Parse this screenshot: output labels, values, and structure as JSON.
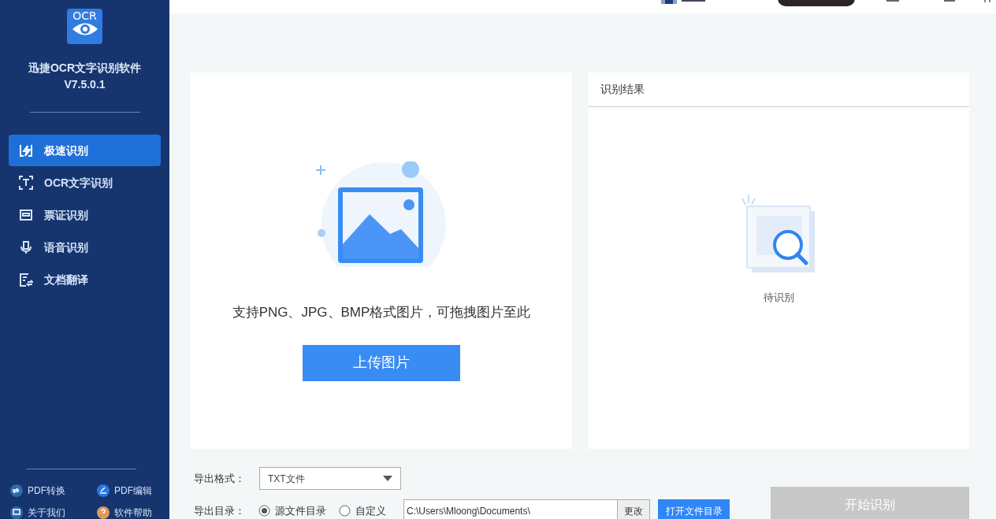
{
  "app": {
    "logo_text": "OCR",
    "name": "迅捷OCR文字识别软件",
    "version": "V7.5.0.1"
  },
  "nav": [
    {
      "label": "极速识别",
      "kind": "flash",
      "selected": true
    },
    {
      "label": "OCR文字识别",
      "kind": "text",
      "selected": false
    },
    {
      "label": "票证识别",
      "kind": "ticket",
      "selected": false
    },
    {
      "label": "语音识别",
      "kind": "mic",
      "selected": false
    },
    {
      "label": "文档翻译",
      "kind": "translate",
      "selected": false
    }
  ],
  "bottom_links": [
    {
      "label": "PDF转换",
      "kind": "convert",
      "color": "#2f6aa8"
    },
    {
      "label": "PDF编辑",
      "kind": "edit",
      "color": "#2576e8"
    },
    {
      "label": "关于我们",
      "kind": "about",
      "color": "#2f6aa8"
    },
    {
      "label": "软件帮助",
      "kind": "help",
      "color": "#e0995a"
    }
  ],
  "upload": {
    "hint": "支持PNG、JPG、BMP格式图片，可拖拽图片至此",
    "button": "上传图片"
  },
  "result": {
    "title": "识别结果",
    "status": "待识别"
  },
  "export": {
    "format_label": "导出格式：",
    "format_value": "TXT文件",
    "dir_label": "导出目录：",
    "dir_options": [
      {
        "label": "源文件目录",
        "selected": true
      },
      {
        "label": "自定义",
        "selected": false
      }
    ],
    "path": "C:\\Users\\Mloong\\Documents\\",
    "change_button": "更改",
    "open_button": "打开文件目录"
  },
  "start_button": {
    "label": "开始识别",
    "disabled": true
  }
}
